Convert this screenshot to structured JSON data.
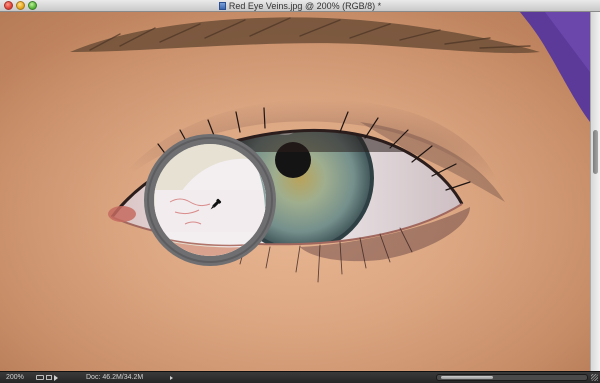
{
  "window": {
    "title": "Red Eye Veins.jpg @ 200% (RGB/8) *",
    "controls": [
      "close-button",
      "minimize-button",
      "zoom-button"
    ]
  },
  "canvas": {
    "tool": "color-replacement-brush",
    "cursor": "eyedropper-icon"
  },
  "statusbar": {
    "zoom": "200%",
    "doc_size": "Doc: 46.2M/34.2M"
  },
  "colors": {
    "skin": "#dca681",
    "iris": "#7f9a93",
    "brush_ring_outer": "#6f6f72",
    "brush_ring_inner": "#e6e1d2",
    "purple_cloth": "#5b3a9a"
  }
}
